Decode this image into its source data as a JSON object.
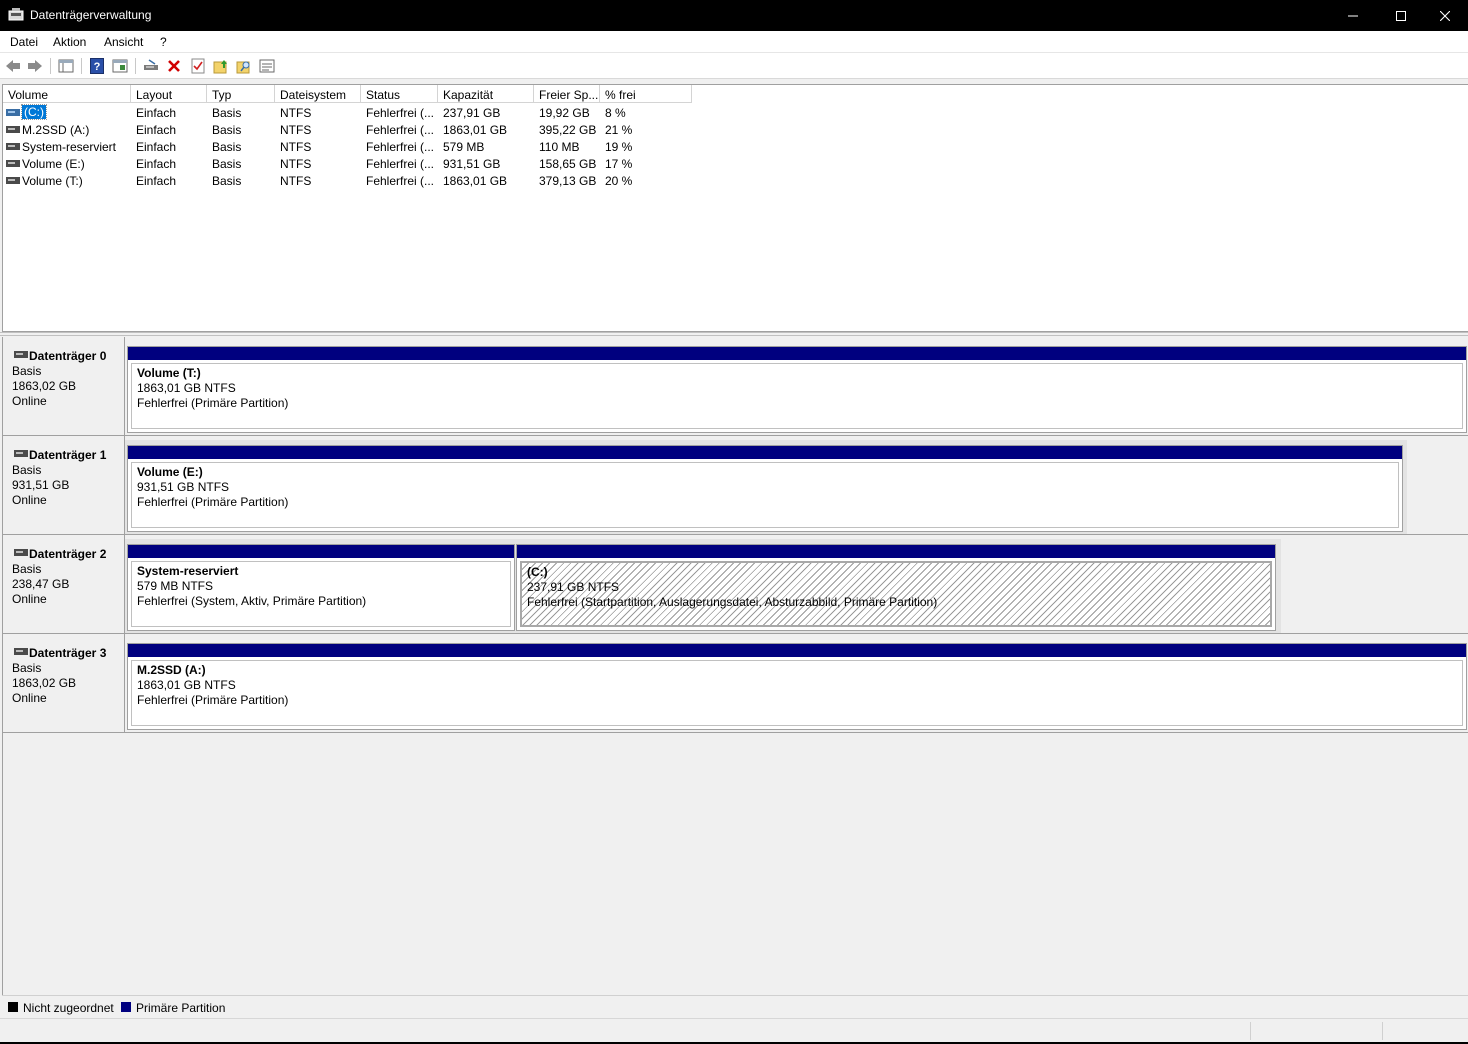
{
  "window": {
    "title": "Datenträgerverwaltung",
    "min_icon": "minimize-icon",
    "max_icon": "maximize-icon",
    "close_icon": "close-icon"
  },
  "menu": [
    "Datei",
    "Aktion",
    "Ansicht",
    "?"
  ],
  "toolbar": [
    "back-icon",
    "forward-icon",
    "console-tree-icon",
    "help-icon",
    "properties-view-icon",
    "connect-disk-icon",
    "delete-icon",
    "check-icon",
    "folder-up-icon",
    "folder-search-icon",
    "settings-panel-icon"
  ],
  "volume_list": {
    "columns": [
      "Volume",
      "Layout",
      "Typ",
      "Dateisystem",
      "Status",
      "Kapazität",
      "Freier Sp...",
      "% frei"
    ],
    "rows": [
      {
        "volume": "(C:)",
        "layout": "Einfach",
        "typ": "Basis",
        "fs": "NTFS",
        "status": "Fehlerfrei (...",
        "cap": "237,91 GB",
        "free": "19,92 GB",
        "pct": "8 %"
      },
      {
        "volume": "M.2SSD (A:)",
        "layout": "Einfach",
        "typ": "Basis",
        "fs": "NTFS",
        "status": "Fehlerfrei (...",
        "cap": "1863,01 GB",
        "free": "395,22 GB",
        "pct": "21 %"
      },
      {
        "volume": "System-reserviert",
        "layout": "Einfach",
        "typ": "Basis",
        "fs": "NTFS",
        "status": "Fehlerfrei (...",
        "cap": "579 MB",
        "free": "110 MB",
        "pct": "19 %"
      },
      {
        "volume": "Volume (E:)",
        "layout": "Einfach",
        "typ": "Basis",
        "fs": "NTFS",
        "status": "Fehlerfrei (...",
        "cap": "931,51 GB",
        "free": "158,65 GB",
        "pct": "17 %"
      },
      {
        "volume": "Volume (T:)",
        "layout": "Einfach",
        "typ": "Basis",
        "fs": "NTFS",
        "status": "Fehlerfrei (...",
        "cap": "1863,01 GB",
        "free": "379,13 GB",
        "pct": "20 %"
      }
    ]
  },
  "disks": [
    {
      "name": "Datenträger 0",
      "type": "Basis",
      "size": "1863,02 GB",
      "state": "Online",
      "partitions": [
        {
          "name": "Volume  (T:)",
          "size": "1863,01 GB NTFS",
          "status": "Fehlerfrei (Primäre Partition)"
        }
      ]
    },
    {
      "name": "Datenträger 1",
      "type": "Basis",
      "size": "931,51 GB",
      "state": "Online",
      "partitions": [
        {
          "name": "Volume  (E:)",
          "size": "931,51 GB NTFS",
          "status": "Fehlerfrei (Primäre Partition)"
        }
      ]
    },
    {
      "name": "Datenträger 2",
      "type": "Basis",
      "size": "238,47 GB",
      "state": "Online",
      "partitions": [
        {
          "name": "System-reserviert",
          "size": "579 MB NTFS",
          "status": "Fehlerfrei (System, Aktiv, Primäre Partition)"
        },
        {
          "name": "(C:)",
          "size": "237,91 GB NTFS",
          "status": "Fehlerfrei (Startpartition, Auslagerungsdatei, Absturzabbild, Primäre Partition)"
        }
      ]
    },
    {
      "name": "Datenträger 3",
      "type": "Basis",
      "size": "1863,02 GB",
      "state": "Online",
      "partitions": [
        {
          "name": "M.2SSD  (A:)",
          "size": "1863,01 GB NTFS",
          "status": "Fehlerfrei (Primäre Partition)"
        }
      ]
    }
  ],
  "legend": [
    {
      "label": "Nicht zugeordnet",
      "color": "#000000"
    },
    {
      "label": "Primäre Partition",
      "color": "#00007f"
    }
  ],
  "colors": {
    "primary_partition": "#00007f",
    "selection": "#0078d7"
  }
}
